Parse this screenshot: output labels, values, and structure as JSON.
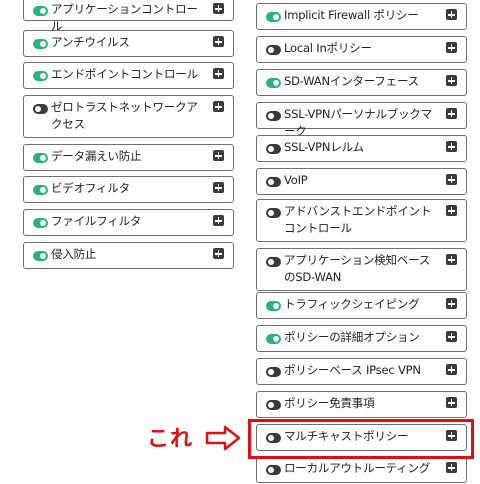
{
  "left_policies": [
    {
      "label": "アプリケーションコントロール",
      "enabled": true
    },
    {
      "label": "アンチウイルス",
      "enabled": true
    },
    {
      "label": "エンドポイントコントロール",
      "enabled": true
    },
    {
      "label": "ゼロトラストネットワークアクセス",
      "enabled": false
    },
    {
      "label": "データ漏えい防止",
      "enabled": true
    },
    {
      "label": "ビデオフィルタ",
      "enabled": true
    },
    {
      "label": "ファイルフィルタ",
      "enabled": true
    },
    {
      "label": "侵入防止",
      "enabled": true
    }
  ],
  "right_policies": [
    {
      "label": "Implicit Firewall ポリシー",
      "enabled": true
    },
    {
      "label": "Local Inポリシー",
      "enabled": false
    },
    {
      "label": "SD-WANインターフェース",
      "enabled": true
    },
    {
      "label": "SSL-VPNパーソナルブックマーク",
      "enabled": false
    },
    {
      "label": "SSL-VPNレルム",
      "enabled": false
    },
    {
      "label": "VoIP",
      "enabled": false
    },
    {
      "label": "アドバンストエンドポイントコントロール",
      "enabled": false
    },
    {
      "label": "アプリケーション検知ベースのSD-WAN",
      "enabled": false
    },
    {
      "label": "トラフィックシェイピング",
      "enabled": true
    },
    {
      "label": "ポリシーの詳細オプション",
      "enabled": true
    },
    {
      "label": "ポリシーベース IPsec VPN",
      "enabled": false
    },
    {
      "label": "ポリシー免責事項",
      "enabled": false
    },
    {
      "label": "マルチキャストポリシー",
      "enabled": false
    },
    {
      "label": "ローカルアウトルーティング",
      "enabled": false
    }
  ],
  "annotation": {
    "text": "これ",
    "color": "#e30e14"
  },
  "colors": {
    "toggle_on": "#2ab27b",
    "toggle_off": "#3a3a3a",
    "highlight": "#e30e14"
  }
}
